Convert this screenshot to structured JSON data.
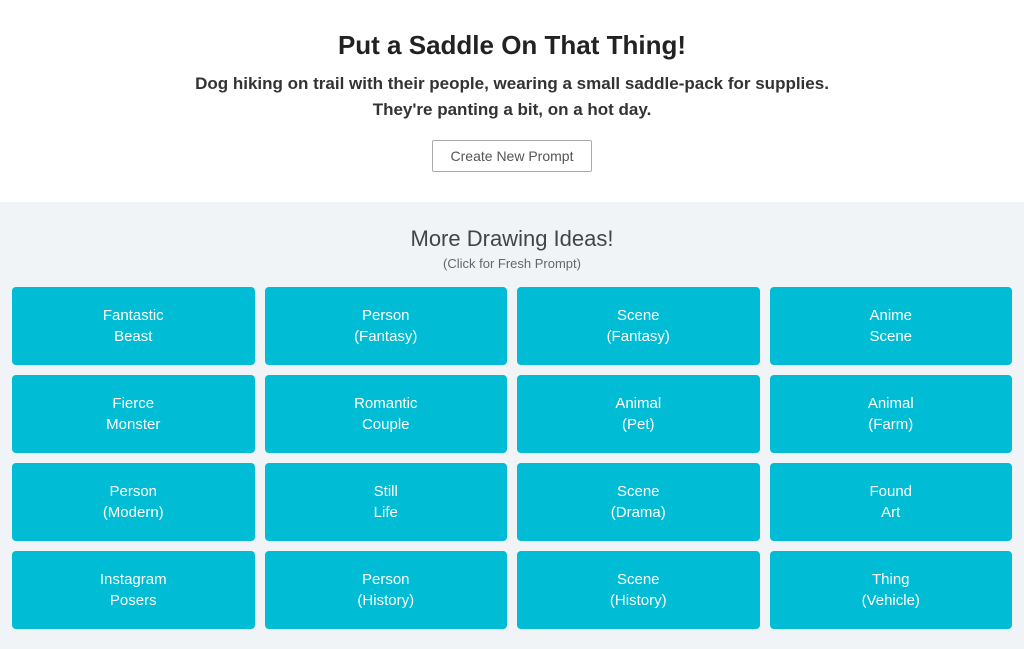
{
  "header": {
    "title": "Put a Saddle On That Thing!",
    "subtitle_line1": "Dog hiking on trail with their people, wearing a small saddle-pack for supplies.",
    "subtitle_line2": "They're panting a bit, on a hot day.",
    "create_button_label": "Create New Prompt"
  },
  "drawing_section": {
    "section_title": "More Drawing Ideas!",
    "click_hint": "(Click for Fresh Prompt)",
    "items": [
      {
        "line1": "Fantastic",
        "line2": "Beast"
      },
      {
        "line1": "Person",
        "line2": "(Fantasy)"
      },
      {
        "line1": "Scene",
        "line2": "(Fantasy)"
      },
      {
        "line1": "Anime",
        "line2": "Scene"
      },
      {
        "line1": "Fierce",
        "line2": "Monster"
      },
      {
        "line1": "Romantic",
        "line2": "Couple"
      },
      {
        "line1": "Animal",
        "line2": "(Pet)"
      },
      {
        "line1": "Animal",
        "line2": "(Farm)"
      },
      {
        "line1": "Person",
        "line2": "(Modern)"
      },
      {
        "line1": "Still",
        "line2": "Life"
      },
      {
        "line1": "Scene",
        "line2": "(Drama)"
      },
      {
        "line1": "Found",
        "line2": "Art"
      },
      {
        "line1": "Instagram",
        "line2": "Posers"
      },
      {
        "line1": "Person",
        "line2": "(History)"
      },
      {
        "line1": "Scene",
        "line2": "(History)"
      },
      {
        "line1": "Thing",
        "line2": "(Vehicle)"
      }
    ]
  }
}
